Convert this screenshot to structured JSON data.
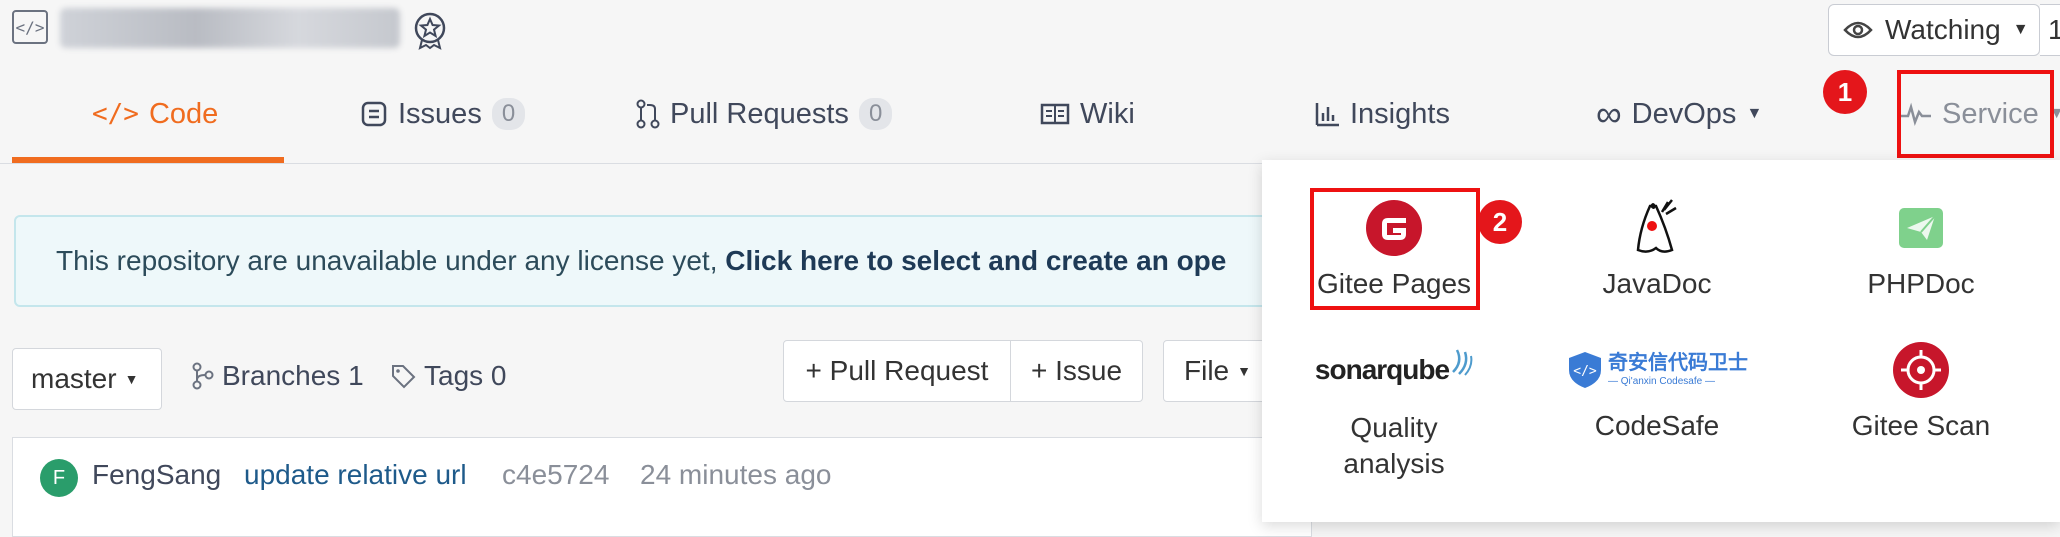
{
  "header": {
    "repo_icon": "code-icon",
    "badge_icon": "award-badge-icon",
    "watch_label": "Watching",
    "watch_count": "1"
  },
  "nav": {
    "tabs": [
      {
        "label": "Code",
        "icon": "code-icon"
      },
      {
        "label": "Issues",
        "count": "0",
        "icon": "issues-icon"
      },
      {
        "label": "Pull Requests",
        "count": "0",
        "icon": "pull-request-icon"
      },
      {
        "label": "Wiki",
        "icon": "book-icon"
      },
      {
        "label": "Insights",
        "icon": "bar-chart-icon"
      },
      {
        "label": "DevOps",
        "icon": "infinity-icon"
      },
      {
        "label": "Service",
        "icon": "pulse-icon"
      }
    ]
  },
  "banner": {
    "text": "This repository are unavailable under any license yet, ",
    "link": "Click here to select and create an ope"
  },
  "branch_bar": {
    "branch": "master",
    "branches": "Branches 1",
    "tags": "Tags 0",
    "pull_request_btn": "+ Pull Request",
    "issue_btn": "+ Issue",
    "file_btn": "File"
  },
  "commit": {
    "avatar_letter": "F",
    "author": "FengSang",
    "message": "update relative url",
    "hash": "c4e5724",
    "time": "24 minutes ago"
  },
  "service_menu": {
    "items": [
      {
        "label": "Gitee Pages",
        "icon": "gitee-pages-icon"
      },
      {
        "label": "JavaDoc",
        "icon": "java-duke-icon"
      },
      {
        "label": "PHPDoc",
        "icon": "phpdoc-icon"
      },
      {
        "label": "Quality analysis",
        "icon": "sonarqube-logo-icon"
      },
      {
        "label": "CodeSafe",
        "icon": "codesafe-logo-icon"
      },
      {
        "label": "Gitee Scan",
        "icon": "target-icon"
      }
    ],
    "sonarqube_logo_text": "sonarqube",
    "codesafe_logo_text": "奇安信代码卫士",
    "codesafe_logo_subtext": "— Qi'anxin Codesafe —"
  },
  "annotations": {
    "marker_1": "1",
    "marker_2": "2"
  },
  "colors": {
    "accent": "#f06c1f",
    "highlight_red": "#e11111",
    "link_blue": "#1e5a8a"
  }
}
